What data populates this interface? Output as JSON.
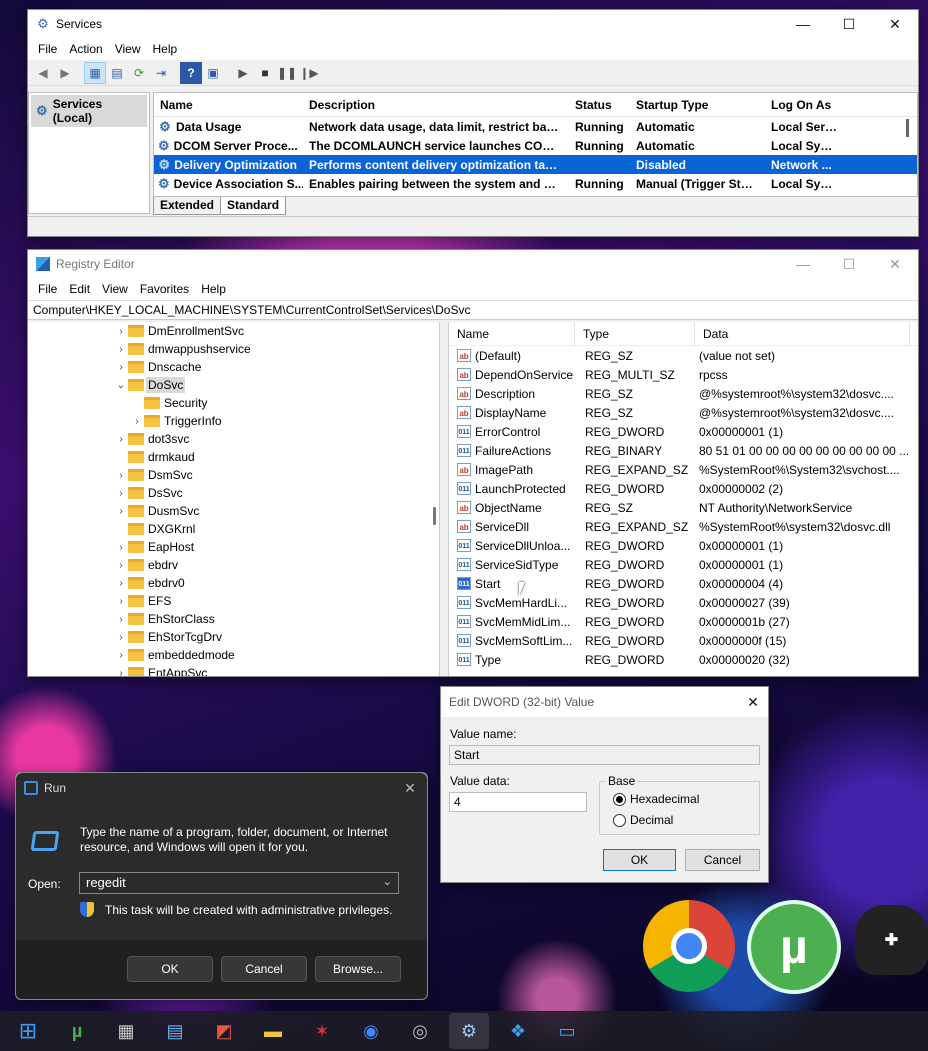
{
  "services": {
    "title": "Services",
    "menu": [
      "File",
      "Action",
      "View",
      "Help"
    ],
    "left_node": "Services (Local)",
    "columns": [
      "Name",
      "Description",
      "Status",
      "Startup Type",
      "Log On As"
    ],
    "rows": [
      {
        "name": "Data Usage",
        "desc": "Network data usage, data limit, restrict bac...",
        "status": "Running",
        "startup": "Automatic",
        "logon": "Local Serv..."
      },
      {
        "name": "DCOM Server Proce...",
        "desc": "The DCOMLAUNCH service launches COM a...",
        "status": "Running",
        "startup": "Automatic",
        "logon": "Local Syst..."
      },
      {
        "name": "Delivery Optimization",
        "desc": "Performs content delivery optimization tasks",
        "status": "",
        "startup": "Disabled",
        "logon": "Network ..."
      },
      {
        "name": "Device Association S...",
        "desc": "Enables pairing between the system and wir...",
        "status": "Running",
        "startup": "Manual (Trigger Start)",
        "logon": "Local Syst..."
      }
    ],
    "tabs": [
      "Extended",
      "Standard"
    ]
  },
  "regedit": {
    "title": "Registry Editor",
    "menu": [
      "File",
      "Edit",
      "View",
      "Favorites",
      "Help"
    ],
    "address": "Computer\\HKEY_LOCAL_MACHINE\\SYSTEM\\CurrentControlSet\\Services\\DoSvc",
    "tree": [
      {
        "label": "DmEnrollmentSvc",
        "level": 0,
        "chev": "›"
      },
      {
        "label": "dmwappushservice",
        "level": 0,
        "chev": "›"
      },
      {
        "label": "Dnscache",
        "level": 0,
        "chev": "›"
      },
      {
        "label": "DoSvc",
        "level": 0,
        "chev": "⌄",
        "selected": true
      },
      {
        "label": "Security",
        "level": 1,
        "chev": ""
      },
      {
        "label": "TriggerInfo",
        "level": 1,
        "chev": "›"
      },
      {
        "label": "dot3svc",
        "level": 0,
        "chev": "›"
      },
      {
        "label": "drmkaud",
        "level": 0,
        "chev": ""
      },
      {
        "label": "DsmSvc",
        "level": 0,
        "chev": "›"
      },
      {
        "label": "DsSvc",
        "level": 0,
        "chev": "›"
      },
      {
        "label": "DusmSvc",
        "level": 0,
        "chev": "›"
      },
      {
        "label": "DXGKrnl",
        "level": 0,
        "chev": ""
      },
      {
        "label": "EapHost",
        "level": 0,
        "chev": "›"
      },
      {
        "label": "ebdrv",
        "level": 0,
        "chev": "›"
      },
      {
        "label": "ebdrv0",
        "level": 0,
        "chev": "›"
      },
      {
        "label": "EFS",
        "level": 0,
        "chev": "›"
      },
      {
        "label": "EhStorClass",
        "level": 0,
        "chev": "›"
      },
      {
        "label": "EhStorTcgDrv",
        "level": 0,
        "chev": "›"
      },
      {
        "label": "embeddedmode",
        "level": 0,
        "chev": "›"
      },
      {
        "label": "EntAppSvc",
        "level": 0,
        "chev": "›"
      }
    ],
    "value_columns": [
      "Name",
      "Type",
      "Data"
    ],
    "values": [
      {
        "icon": "ab",
        "name": "(Default)",
        "type": "REG_SZ",
        "data": "(value not set)"
      },
      {
        "icon": "ab",
        "name": "DependOnService",
        "type": "REG_MULTI_SZ",
        "data": "rpcss"
      },
      {
        "icon": "ab",
        "name": "Description",
        "type": "REG_SZ",
        "data": "@%systemroot%\\system32\\dosvc...."
      },
      {
        "icon": "ab",
        "name": "DisplayName",
        "type": "REG_SZ",
        "data": "@%systemroot%\\system32\\dosvc...."
      },
      {
        "icon": "011",
        "name": "ErrorControl",
        "type": "REG_DWORD",
        "data": "0x00000001 (1)"
      },
      {
        "icon": "011",
        "name": "FailureActions",
        "type": "REG_BINARY",
        "data": "80 51 01 00 00 00 00 00 00 00 00 00 ..."
      },
      {
        "icon": "ab",
        "name": "ImagePath",
        "type": "REG_EXPAND_SZ",
        "data": "%SystemRoot%\\System32\\svchost...."
      },
      {
        "icon": "011",
        "name": "LaunchProtected",
        "type": "REG_DWORD",
        "data": "0x00000002 (2)"
      },
      {
        "icon": "ab",
        "name": "ObjectName",
        "type": "REG_SZ",
        "data": "NT Authority\\NetworkService"
      },
      {
        "icon": "ab",
        "name": "ServiceDll",
        "type": "REG_EXPAND_SZ",
        "data": "%SystemRoot%\\system32\\dosvc.dll"
      },
      {
        "icon": "011",
        "name": "ServiceDllUnloa...",
        "type": "REG_DWORD",
        "data": "0x00000001 (1)"
      },
      {
        "icon": "011",
        "name": "ServiceSidType",
        "type": "REG_DWORD",
        "data": "0x00000001 (1)"
      },
      {
        "icon": "011",
        "name": "Start",
        "type": "REG_DWORD",
        "data": "0x00000004 (4)",
        "selected": true
      },
      {
        "icon": "011",
        "name": "SvcMemHardLi...",
        "type": "REG_DWORD",
        "data": "0x00000027 (39)"
      },
      {
        "icon": "011",
        "name": "SvcMemMidLim...",
        "type": "REG_DWORD",
        "data": "0x0000001b (27)"
      },
      {
        "icon": "011",
        "name": "SvcMemSoftLim...",
        "type": "REG_DWORD",
        "data": "0x0000000f (15)"
      },
      {
        "icon": "011",
        "name": "Type",
        "type": "REG_DWORD",
        "data": "0x00000020 (32)"
      }
    ]
  },
  "dword": {
    "title": "Edit DWORD (32-bit) Value",
    "value_name_label": "Value name:",
    "value_name": "Start",
    "value_data_label": "Value data:",
    "value_data": "4",
    "base_label": "Base",
    "hex_label": "Hexadecimal",
    "dec_label": "Decimal",
    "ok": "OK",
    "cancel": "Cancel"
  },
  "run": {
    "title": "Run",
    "description": "Type the name of a program, folder, document, or Internet resource, and Windows will open it for you.",
    "open_label": "Open:",
    "open_value": "regedit",
    "admin_note": "This task will be created with administrative privileges.",
    "ok": "OK",
    "cancel": "Cancel",
    "browse": "Browse..."
  },
  "taskbar": {
    "icons": [
      "windows-start-icon",
      "utorrent-icon",
      "calculator-icon",
      "notepad-icon",
      "store-icon",
      "file-explorer-icon",
      "game-icon",
      "chrome-icon",
      "webcam-icon",
      "services-gear-icon",
      "registry-icon",
      "run-icon"
    ]
  },
  "colors": {
    "selection": "#0a64d6",
    "folder": "#f5c342",
    "run_dark": "#2b2b2b"
  }
}
